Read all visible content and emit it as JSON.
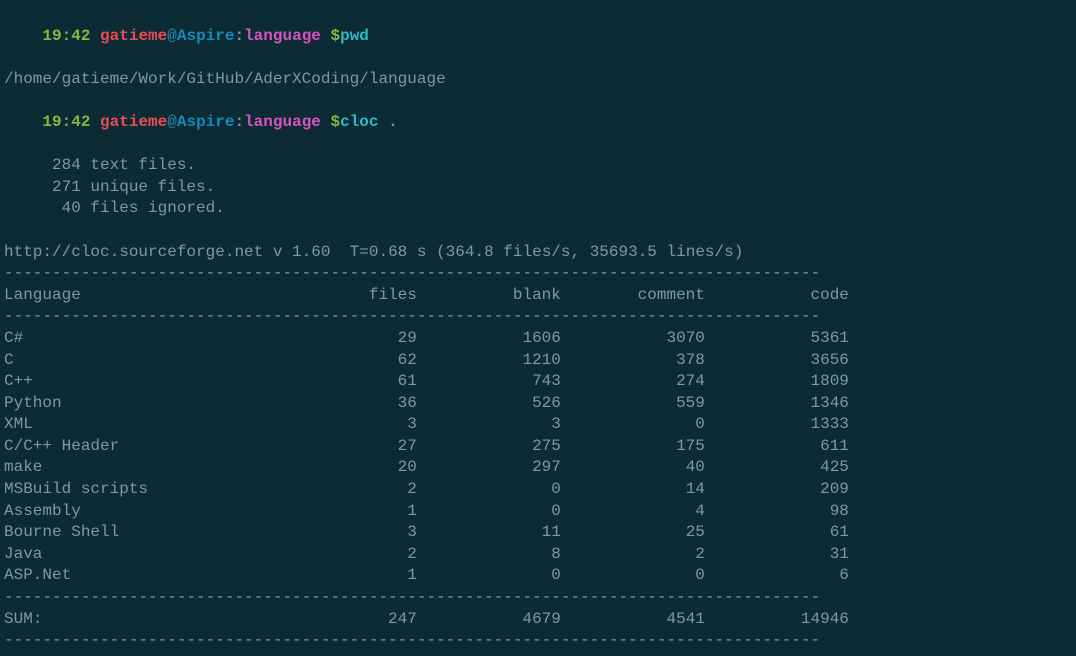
{
  "prompt1": {
    "time": "19:42",
    "user": "gatieme",
    "at": "@",
    "host": "Aspire",
    "colon": ":",
    "path": "language",
    "dollar": " $",
    "cmd": "pwd"
  },
  "pwd_output": "/home/gatieme/Work/GitHub/AderXCoding/language",
  "prompt2": {
    "time": "19:42",
    "user": "gatieme",
    "at": "@",
    "host": "Aspire",
    "colon": ":",
    "path": "language",
    "dollar": " $",
    "cmd": "cloc ."
  },
  "summary_lines": [
    "     284 text files.",
    "     271 unique files.",
    "      40 files ignored."
  ],
  "stats_line": "http://cloc.sourceforge.net v 1.60  T=0.68 s (364.8 files/s, 35693.5 lines/s)",
  "sep": "-------------------------------------------------------------------------------------",
  "header": {
    "lang": "Language",
    "files": "files",
    "blank": "blank",
    "comment": "comment",
    "code": "code"
  },
  "rows": [
    {
      "lang": "C#",
      "files": "29",
      "blank": "1606",
      "comment": "3070",
      "code": "5361"
    },
    {
      "lang": "C",
      "files": "62",
      "blank": "1210",
      "comment": "378",
      "code": "3656"
    },
    {
      "lang": "C++",
      "files": "61",
      "blank": "743",
      "comment": "274",
      "code": "1809"
    },
    {
      "lang": "Python",
      "files": "36",
      "blank": "526",
      "comment": "559",
      "code": "1346"
    },
    {
      "lang": "XML",
      "files": "3",
      "blank": "3",
      "comment": "0",
      "code": "1333"
    },
    {
      "lang": "C/C++ Header",
      "files": "27",
      "blank": "275",
      "comment": "175",
      "code": "611"
    },
    {
      "lang": "make",
      "files": "20",
      "blank": "297",
      "comment": "40",
      "code": "425"
    },
    {
      "lang": "MSBuild scripts",
      "files": "2",
      "blank": "0",
      "comment": "14",
      "code": "209"
    },
    {
      "lang": "Assembly",
      "files": "1",
      "blank": "0",
      "comment": "4",
      "code": "98"
    },
    {
      "lang": "Bourne Shell",
      "files": "3",
      "blank": "11",
      "comment": "25",
      "code": "61"
    },
    {
      "lang": "Java",
      "files": "2",
      "blank": "8",
      "comment": "2",
      "code": "31"
    },
    {
      "lang": "ASP.Net",
      "files": "1",
      "blank": "0",
      "comment": "0",
      "code": "6"
    }
  ],
  "sum": {
    "lang": "SUM:",
    "files": "247",
    "blank": "4679",
    "comment": "4541",
    "code": "14946"
  },
  "chart_data": {
    "type": "table",
    "title": "cloc output",
    "columns": [
      "Language",
      "files",
      "blank",
      "comment",
      "code"
    ],
    "rows": [
      [
        "C#",
        29,
        1606,
        3070,
        5361
      ],
      [
        "C",
        62,
        1210,
        378,
        3656
      ],
      [
        "C++",
        61,
        743,
        274,
        1809
      ],
      [
        "Python",
        36,
        526,
        559,
        1346
      ],
      [
        "XML",
        3,
        3,
        0,
        1333
      ],
      [
        "C/C++ Header",
        27,
        275,
        175,
        611
      ],
      [
        "make",
        20,
        297,
        40,
        425
      ],
      [
        "MSBuild scripts",
        2,
        0,
        14,
        209
      ],
      [
        "Assembly",
        1,
        0,
        4,
        98
      ],
      [
        "Bourne Shell",
        3,
        11,
        25,
        61
      ],
      [
        "Java",
        2,
        8,
        2,
        31
      ],
      [
        "ASP.Net",
        1,
        0,
        0,
        6
      ]
    ],
    "sum": [
      "SUM:",
      247,
      4679,
      4541,
      14946
    ]
  }
}
